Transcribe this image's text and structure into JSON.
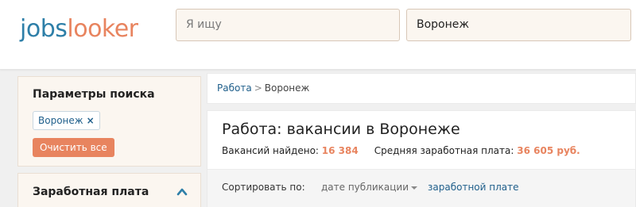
{
  "header": {
    "logo_part1": "jobs",
    "logo_part2": "looker",
    "search_query_placeholder": "Я ищу",
    "search_location_value": "Воронеж"
  },
  "sidebar": {
    "params_title": "Параметры поиска",
    "filter_tag_label": "Воронеж",
    "filter_tag_remove": "×",
    "clear_all_label": "Очистить все",
    "salary_title": "Заработная плата"
  },
  "breadcrumb": {
    "link": "Работа",
    "separator": ">",
    "current": "Воронеж"
  },
  "main": {
    "title": "Работа: вакансии в Воронеже",
    "found_label": "Вакансий найдено:",
    "found_count": "16 384",
    "avg_salary_label": "Средняя заработная плата:",
    "avg_salary_value": "36 605 руб."
  },
  "sort": {
    "label": "Сортировать по:",
    "by_date": "дате публикации",
    "by_salary": "заработной плате"
  },
  "colors": {
    "accent_orange": "#e8845f",
    "link_blue": "#1f5f8b",
    "logo_blue": "#2e7fa8"
  }
}
